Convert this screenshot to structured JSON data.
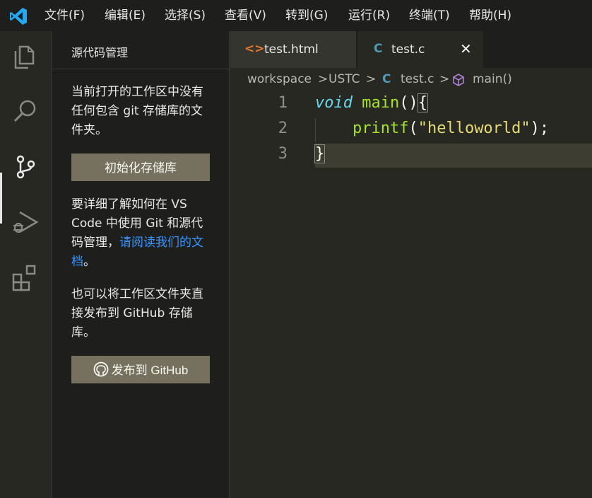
{
  "menu": [
    "文件(F)",
    "编辑(E)",
    "选择(S)",
    "查看(V)",
    "转到(G)",
    "运行(R)",
    "终端(T)",
    "帮助(H)"
  ],
  "activity_icons": [
    "explorer-icon",
    "search-icon",
    "source-control-icon",
    "run-debug-icon",
    "extensions-icon"
  ],
  "sidebar": {
    "title": "源代码管理",
    "msg1": "当前打开的工作区中没有任何包含 git 存储库的文件夹。",
    "init_button": "初始化存储库",
    "msg2_prefix": "要详细了解如何在 VS Code 中使用 Git 和源代码管理，",
    "msg2_link": "请阅读我们的文档",
    "msg2_suffix": "。",
    "msg3": "也可以将工作区文件夹直接发布到 GitHub 存储库。",
    "publish_button": "发布到 GitHub"
  },
  "tabs": [
    {
      "icon": "<>",
      "label": "test.html",
      "active": false
    },
    {
      "icon": "C",
      "label": "test.c",
      "active": true
    }
  ],
  "tab_close": "✕",
  "breadcrumb": {
    "parts": [
      "workspace",
      "USTC",
      "test.c",
      "main()"
    ],
    "separator": ">",
    "c_icon": "C"
  },
  "editor": {
    "line_numbers": [
      "1",
      "2",
      "3"
    ],
    "line1": {
      "kw": "void",
      "fn": "main",
      "parens": "()",
      "brace": "{"
    },
    "line2": {
      "indent": "    ",
      "fn": "printf",
      "open": "(",
      "str": "\"helloworld\"",
      "close": ");"
    },
    "line3": {
      "brace": "}"
    }
  },
  "colors": {
    "accent": "#007acc",
    "link": "#3794ff",
    "button": "#75715e",
    "keyword": "#66d9ef",
    "function": "#a6e22e",
    "string": "#e6db74"
  }
}
